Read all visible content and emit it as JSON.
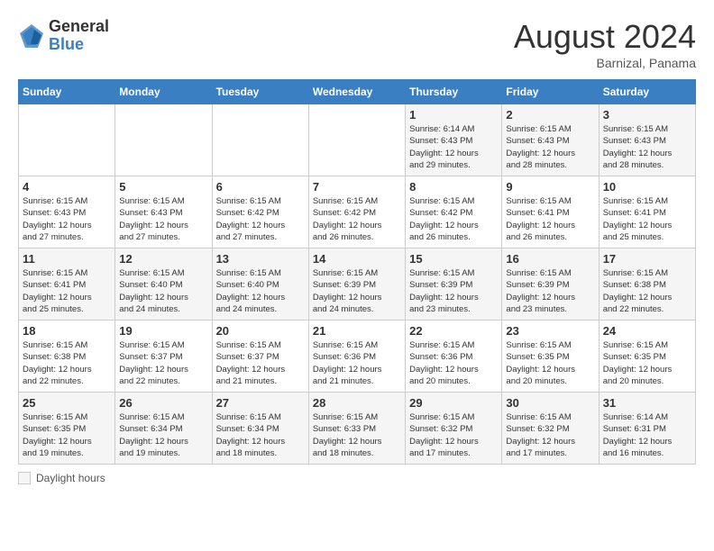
{
  "header": {
    "logo_general": "General",
    "logo_blue": "Blue",
    "month_title": "August 2024",
    "location": "Barnizal, Panama"
  },
  "footer": {
    "daylight_label": "Daylight hours"
  },
  "weekdays": [
    "Sunday",
    "Monday",
    "Tuesday",
    "Wednesday",
    "Thursday",
    "Friday",
    "Saturday"
  ],
  "weeks": [
    [
      {
        "day": "",
        "info": ""
      },
      {
        "day": "",
        "info": ""
      },
      {
        "day": "",
        "info": ""
      },
      {
        "day": "",
        "info": ""
      },
      {
        "day": "1",
        "info": "Sunrise: 6:14 AM\nSunset: 6:43 PM\nDaylight: 12 hours\nand 29 minutes."
      },
      {
        "day": "2",
        "info": "Sunrise: 6:15 AM\nSunset: 6:43 PM\nDaylight: 12 hours\nand 28 minutes."
      },
      {
        "day": "3",
        "info": "Sunrise: 6:15 AM\nSunset: 6:43 PM\nDaylight: 12 hours\nand 28 minutes."
      }
    ],
    [
      {
        "day": "4",
        "info": "Sunrise: 6:15 AM\nSunset: 6:43 PM\nDaylight: 12 hours\nand 27 minutes."
      },
      {
        "day": "5",
        "info": "Sunrise: 6:15 AM\nSunset: 6:43 PM\nDaylight: 12 hours\nand 27 minutes."
      },
      {
        "day": "6",
        "info": "Sunrise: 6:15 AM\nSunset: 6:42 PM\nDaylight: 12 hours\nand 27 minutes."
      },
      {
        "day": "7",
        "info": "Sunrise: 6:15 AM\nSunset: 6:42 PM\nDaylight: 12 hours\nand 26 minutes."
      },
      {
        "day": "8",
        "info": "Sunrise: 6:15 AM\nSunset: 6:42 PM\nDaylight: 12 hours\nand 26 minutes."
      },
      {
        "day": "9",
        "info": "Sunrise: 6:15 AM\nSunset: 6:41 PM\nDaylight: 12 hours\nand 26 minutes."
      },
      {
        "day": "10",
        "info": "Sunrise: 6:15 AM\nSunset: 6:41 PM\nDaylight: 12 hours\nand 25 minutes."
      }
    ],
    [
      {
        "day": "11",
        "info": "Sunrise: 6:15 AM\nSunset: 6:41 PM\nDaylight: 12 hours\nand 25 minutes."
      },
      {
        "day": "12",
        "info": "Sunrise: 6:15 AM\nSunset: 6:40 PM\nDaylight: 12 hours\nand 24 minutes."
      },
      {
        "day": "13",
        "info": "Sunrise: 6:15 AM\nSunset: 6:40 PM\nDaylight: 12 hours\nand 24 minutes."
      },
      {
        "day": "14",
        "info": "Sunrise: 6:15 AM\nSunset: 6:39 PM\nDaylight: 12 hours\nand 24 minutes."
      },
      {
        "day": "15",
        "info": "Sunrise: 6:15 AM\nSunset: 6:39 PM\nDaylight: 12 hours\nand 23 minutes."
      },
      {
        "day": "16",
        "info": "Sunrise: 6:15 AM\nSunset: 6:39 PM\nDaylight: 12 hours\nand 23 minutes."
      },
      {
        "day": "17",
        "info": "Sunrise: 6:15 AM\nSunset: 6:38 PM\nDaylight: 12 hours\nand 22 minutes."
      }
    ],
    [
      {
        "day": "18",
        "info": "Sunrise: 6:15 AM\nSunset: 6:38 PM\nDaylight: 12 hours\nand 22 minutes."
      },
      {
        "day": "19",
        "info": "Sunrise: 6:15 AM\nSunset: 6:37 PM\nDaylight: 12 hours\nand 22 minutes."
      },
      {
        "day": "20",
        "info": "Sunrise: 6:15 AM\nSunset: 6:37 PM\nDaylight: 12 hours\nand 21 minutes."
      },
      {
        "day": "21",
        "info": "Sunrise: 6:15 AM\nSunset: 6:36 PM\nDaylight: 12 hours\nand 21 minutes."
      },
      {
        "day": "22",
        "info": "Sunrise: 6:15 AM\nSunset: 6:36 PM\nDaylight: 12 hours\nand 20 minutes."
      },
      {
        "day": "23",
        "info": "Sunrise: 6:15 AM\nSunset: 6:35 PM\nDaylight: 12 hours\nand 20 minutes."
      },
      {
        "day": "24",
        "info": "Sunrise: 6:15 AM\nSunset: 6:35 PM\nDaylight: 12 hours\nand 20 minutes."
      }
    ],
    [
      {
        "day": "25",
        "info": "Sunrise: 6:15 AM\nSunset: 6:35 PM\nDaylight: 12 hours\nand 19 minutes."
      },
      {
        "day": "26",
        "info": "Sunrise: 6:15 AM\nSunset: 6:34 PM\nDaylight: 12 hours\nand 19 minutes."
      },
      {
        "day": "27",
        "info": "Sunrise: 6:15 AM\nSunset: 6:34 PM\nDaylight: 12 hours\nand 18 minutes."
      },
      {
        "day": "28",
        "info": "Sunrise: 6:15 AM\nSunset: 6:33 PM\nDaylight: 12 hours\nand 18 minutes."
      },
      {
        "day": "29",
        "info": "Sunrise: 6:15 AM\nSunset: 6:32 PM\nDaylight: 12 hours\nand 17 minutes."
      },
      {
        "day": "30",
        "info": "Sunrise: 6:15 AM\nSunset: 6:32 PM\nDaylight: 12 hours\nand 17 minutes."
      },
      {
        "day": "31",
        "info": "Sunrise: 6:14 AM\nSunset: 6:31 PM\nDaylight: 12 hours\nand 16 minutes."
      }
    ]
  ]
}
